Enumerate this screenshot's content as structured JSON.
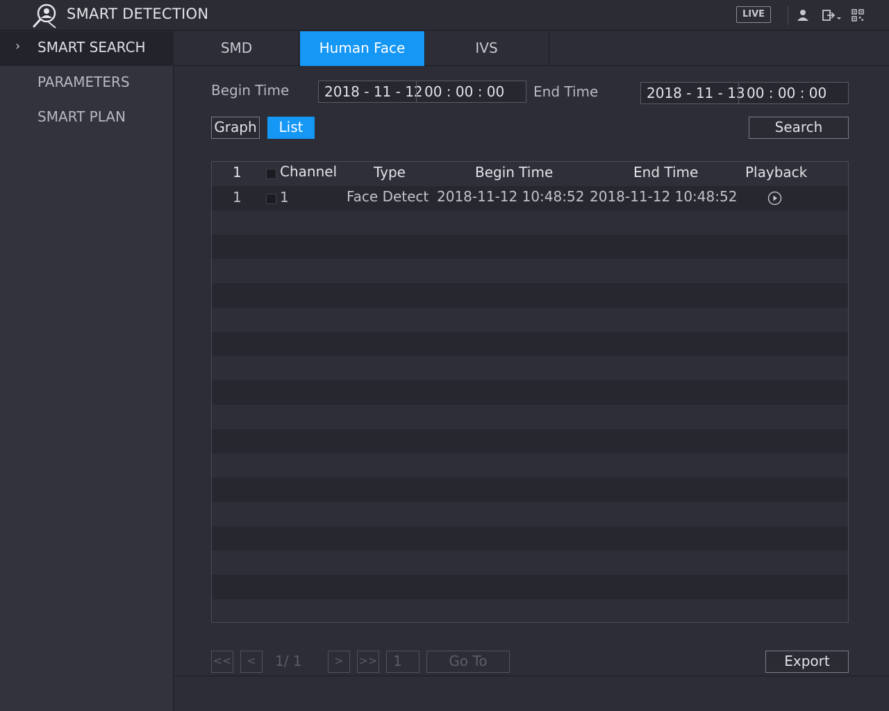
{
  "header": {
    "title": "SMART DETECTION",
    "live_label": "LIVE"
  },
  "sidebar": {
    "items": [
      {
        "label": "SMART SEARCH",
        "active": true
      },
      {
        "label": "PARAMETERS",
        "active": false
      },
      {
        "label": "SMART PLAN",
        "active": false
      }
    ]
  },
  "tabs": [
    {
      "label": "SMD",
      "active": false
    },
    {
      "label": "Human Face",
      "active": true
    },
    {
      "label": "IVS",
      "active": false
    }
  ],
  "search": {
    "begin_label": "Begin Time",
    "begin_date": "2018 - 11 - 12",
    "begin_time": "00 : 00 : 00",
    "end_label": "End Time",
    "end_date": "2018 - 11 - 13",
    "end_time": "00 : 00 : 00",
    "graph_label": "Graph",
    "list_label": "List",
    "search_label": "Search"
  },
  "table": {
    "columns": {
      "index": "1",
      "channel": "Channel",
      "type": "Type",
      "begin": "Begin Time",
      "end": "End Time",
      "playback": "Playback"
    },
    "rows": [
      {
        "index": "1",
        "channel": "1",
        "type": "Face Detect",
        "begin": "2018-11-12 10:48:52",
        "end": "2018-11-12 10:48:52"
      }
    ]
  },
  "pagination": {
    "first": "<<",
    "prev": "<",
    "page_info": "1/ 1",
    "next": ">",
    "last": ">>",
    "page_input": "1",
    "goto_label": "Go To",
    "export_label": "Export"
  },
  "colors": {
    "accent": "#1597f5",
    "background": "#2c2d36",
    "sidebar": "#32333d"
  }
}
